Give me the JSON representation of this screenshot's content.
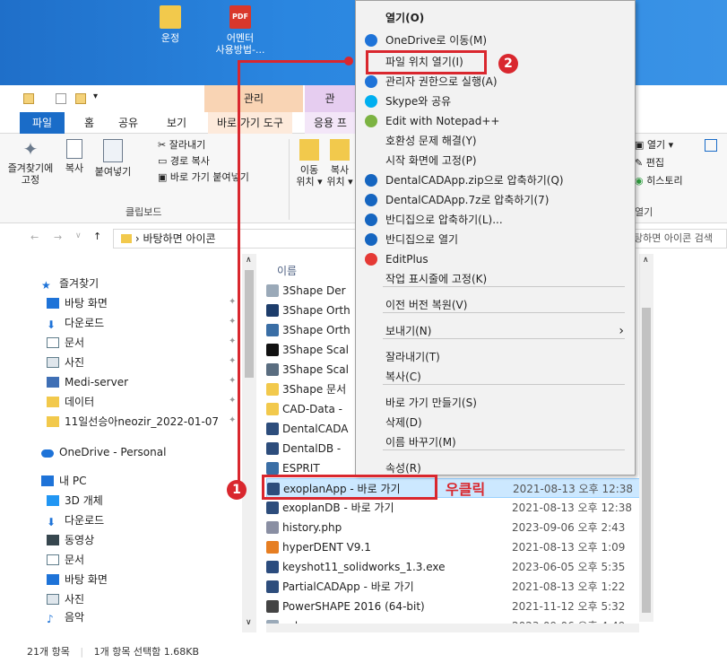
{
  "desktop": {
    "icons": [
      {
        "label": "운정",
        "color": "#f2c94c"
      },
      {
        "label": "어멘터\n사용방법-...",
        "color": "#d9372b",
        "badge": "PDF"
      }
    ]
  },
  "ribbon_tabs": {
    "file": "파일",
    "home": "홈",
    "share": "공유",
    "view": "보기",
    "shortcut_tools": "바로 가기 도구",
    "app_tools": "응용 프",
    "ctx_manage": "관리",
    "ctx_manage2": "관"
  },
  "ribbon": {
    "pin_quick": "즐겨찾기에\n고정",
    "copy": "복사",
    "paste": "붙여넣기",
    "cut": "잘라내기",
    "copy_path": "경로 복사",
    "paste_shortcut": "바로 가기 붙여넣기",
    "clipboard_group": "클립보드",
    "move_to": "이동\n위치 ▾",
    "copy_to": "복사\n위치 ▾",
    "open": "열기 ▾",
    "edit": "편집",
    "history": "히스토리",
    "open_group": "열기"
  },
  "address": {
    "path": "바탕하면 아이콘",
    "search_placeholder": "탕하면 아이콘 검색"
  },
  "nav": {
    "items": [
      {
        "label": "즐겨찾기",
        "color": "#1e73d8",
        "pin": false
      },
      {
        "label": "바탕 화면",
        "color": "#1e73d8",
        "pin": true
      },
      {
        "label": "다운로드",
        "color": "#1e73d8",
        "pin": true
      },
      {
        "label": "문서",
        "color": "#607d8b",
        "pin": true
      },
      {
        "label": "사진",
        "color": "#607d8b",
        "pin": true
      },
      {
        "label": "Medi-server",
        "color": "#3f6fb5",
        "pin": true
      },
      {
        "label": "데이터",
        "color": "#f2c94c",
        "pin": true
      },
      {
        "label": "11일선승아neozir_2022-01-07",
        "color": "#f2c94c",
        "pin": true
      },
      {
        "label": "OneDrive - Personal",
        "color": "#1e73d8",
        "pin": false
      },
      {
        "label": "내 PC",
        "color": "#1e73d8",
        "pin": false
      },
      {
        "label": "3D 개체",
        "color": "#2196f3",
        "pin": false
      },
      {
        "label": "다운로드",
        "color": "#1e73d8",
        "pin": false
      },
      {
        "label": "동영상",
        "color": "#37474f",
        "pin": false
      },
      {
        "label": "문서",
        "color": "#607d8b",
        "pin": false
      },
      {
        "label": "바탕 화면",
        "color": "#1e73d8",
        "pin": false
      },
      {
        "label": "사진",
        "color": "#607d8b",
        "pin": false
      },
      {
        "label": "음악",
        "color": "#1e73d8",
        "pin": false
      }
    ]
  },
  "files": {
    "column_name": "이름",
    "rows": [
      {
        "name": "3Shape Der",
        "date": "",
        "color": "#9aa9b8"
      },
      {
        "name": "3Shape Orth",
        "date": "",
        "color": "#1d3d6b"
      },
      {
        "name": "3Shape Orth",
        "date": "",
        "color": "#3a6ea5"
      },
      {
        "name": "3Shape Scal",
        "date": "",
        "color": "#111"
      },
      {
        "name": "3Shape Scal",
        "date": "",
        "color": "#5a6d80"
      },
      {
        "name": "3Shape 문서",
        "date": "",
        "color": "#f2c94c"
      },
      {
        "name": "CAD-Data -",
        "date": "",
        "color": "#f2c94c"
      },
      {
        "name": "DentalCADA",
        "date": "",
        "color": "#2d4d7c"
      },
      {
        "name": "DentalDB -",
        "date": "",
        "color": "#2d4d7c"
      },
      {
        "name": "ESPRIT",
        "date": "",
        "color": "#3a6ea5"
      },
      {
        "name": "exoplanApp - 바로 가기",
        "date": "2021-08-13 오후 12:38",
        "color": "#2d4d7c"
      },
      {
        "name": "exoplanDB - 바로 가기",
        "date": "2021-08-13 오후 12:38",
        "color": "#2d4d7c"
      },
      {
        "name": "history.php",
        "date": "2023-09-06 오후 2:43",
        "color": "#8a8fa3"
      },
      {
        "name": "hyperDENT V9.1",
        "date": "2021-08-13 오후 1:09",
        "color": "#e67e22"
      },
      {
        "name": "keyshot11_solidworks_1.3.exe",
        "date": "2023-06-05 오후 5:35",
        "color": "#2b4c7e"
      },
      {
        "name": "PartialCADApp - 바로 가기",
        "date": "2021-08-13 오후 1:22",
        "color": "#2d4d7c"
      },
      {
        "name": "PowerSHAPE 2016 (64-bit)",
        "date": "2021-11-12 오후 5:32",
        "color": "#444"
      },
      {
        "name": "sub.css",
        "date": "2023-09-06 오후 4:49",
        "color": "#9aa9b8"
      }
    ]
  },
  "status": {
    "count": "21개 항목",
    "selected": "1개 항목 선택함 1.68KB"
  },
  "context_menu": {
    "items": [
      {
        "label": "열기(O)",
        "bold": true,
        "icon": ""
      },
      {
        "label": "OneDrive로 이동(M)",
        "icon": "#1e73d8"
      },
      {
        "label": "파일 위치 열기(I)",
        "icon": ""
      },
      {
        "label": "관리자 권한으로 실행(A)",
        "icon": "#1e73d8"
      },
      {
        "label": "Skype와 공유",
        "icon": "#00aff0"
      },
      {
        "label": "Edit with Notepad++",
        "icon": "#7cb342"
      },
      {
        "label": "호환성 문제 해결(Y)",
        "icon": ""
      },
      {
        "label": "시작 화면에 고정(P)",
        "icon": ""
      },
      {
        "label": "DentalCADApp.zip으로 압축하기(Q)",
        "icon": "#1565c0"
      },
      {
        "label": "DentalCADApp.7z로 압축하기(7)",
        "icon": "#1565c0"
      },
      {
        "label": "반디집으로 압축하기(L)...",
        "icon": "#1565c0"
      },
      {
        "label": "반디집으로 열기",
        "icon": "#1565c0"
      },
      {
        "label": "EditPlus",
        "icon": "#e53935"
      },
      {
        "label": "작업 표시줄에 고정(K)",
        "icon": ""
      },
      {
        "label": "이전 버전 복원(V)",
        "icon": ""
      },
      {
        "label": "보내기(N)",
        "icon": "",
        "submenu": true
      },
      {
        "label": "잘라내기(T)",
        "icon": ""
      },
      {
        "label": "복사(C)",
        "icon": ""
      },
      {
        "label": "바로 가기 만들기(S)",
        "icon": ""
      },
      {
        "label": "삭제(D)",
        "icon": ""
      },
      {
        "label": "이름 바꾸기(M)",
        "icon": ""
      },
      {
        "label": "속성(R)",
        "icon": ""
      }
    ]
  },
  "annotations": {
    "badge1": "1",
    "badge2": "2",
    "right_click_label": "우클릭"
  },
  "colors": {
    "accent": "#1a6cc8",
    "annotation_red": "#d9272e",
    "selection": "#cce8ff"
  }
}
